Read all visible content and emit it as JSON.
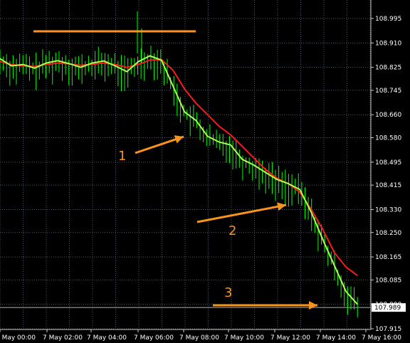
{
  "chart_data": {
    "type": "line",
    "style": "candlestick-style bars with two moving averages",
    "y_ticks": [
      "108.995",
      "108.910",
      "108.825",
      "108.745",
      "108.660",
      "108.580",
      "108.495",
      "108.415",
      "108.330",
      "108.250",
      "108.165",
      "108.085",
      "108.000",
      "107.915"
    ],
    "ylim": [
      107.915,
      108.995
    ],
    "x_ticks": [
      "7 May 00:00",
      "7 May 02:00",
      "7 May 04:00",
      "7 May 06:00",
      "7 May 08:00",
      "7 May 10:00",
      "7 May 12:00",
      "7 May 14:00",
      "7 May 16:00"
    ],
    "current_price": "107.989",
    "grid": "dotted",
    "colors": {
      "background": "#000000",
      "grid": "#4a5a6a",
      "bars": "#00ff00",
      "fast_ma": "#aaff55",
      "slow_ma": "#ff1a1a",
      "annotation": "#f7941d",
      "price_line": "#b0b0b0"
    },
    "series": [
      {
        "role": "fast_ma",
        "x": [
          0,
          1,
          2,
          3,
          4,
          5,
          6,
          7,
          8,
          9,
          10,
          11,
          12,
          13,
          14,
          15,
          16,
          17,
          18,
          19,
          20,
          21,
          22,
          23,
          24,
          25,
          26,
          27,
          28,
          29,
          30,
          31
        ],
        "values": [
          108.855,
          108.83,
          108.835,
          108.822,
          108.84,
          108.848,
          108.838,
          108.825,
          108.84,
          108.847,
          108.83,
          108.81,
          108.845,
          108.865,
          108.85,
          108.76,
          108.67,
          108.64,
          108.585,
          108.565,
          108.555,
          108.505,
          108.485,
          108.46,
          108.435,
          108.42,
          108.4,
          108.32,
          108.225,
          108.135,
          108.045,
          108.0
        ]
      },
      {
        "role": "slow_ma",
        "x": [
          0,
          1,
          2,
          3,
          4,
          5,
          6,
          7,
          8,
          9,
          10,
          11,
          12,
          13,
          14,
          15,
          16,
          17,
          18,
          19,
          20,
          21,
          22,
          23,
          24,
          25,
          26,
          27,
          28,
          29,
          30,
          31
        ],
        "values": [
          108.845,
          108.835,
          108.83,
          108.828,
          108.835,
          108.84,
          108.837,
          108.832,
          108.836,
          108.84,
          108.835,
          108.825,
          108.835,
          108.85,
          108.852,
          108.815,
          108.75,
          108.7,
          108.66,
          108.62,
          108.59,
          108.55,
          108.51,
          108.47,
          108.44,
          108.42,
          108.39,
          108.33,
          108.26,
          108.18,
          108.13,
          108.1
        ]
      }
    ],
    "annotations": [
      {
        "label": "1"
      },
      {
        "label": "2"
      },
      {
        "label": "3"
      }
    ]
  }
}
